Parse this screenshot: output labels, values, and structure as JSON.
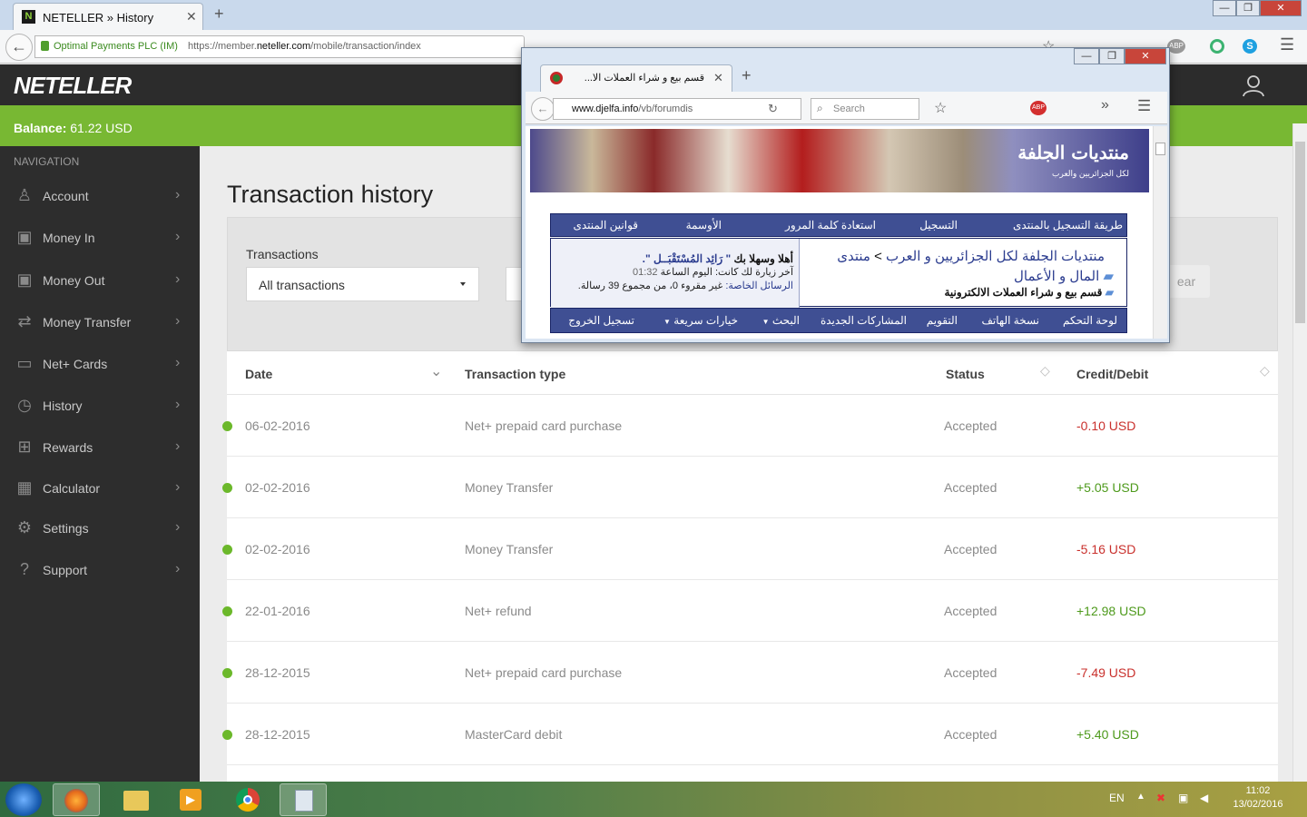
{
  "browser": {
    "tab_title": "NETELLER » History",
    "tab_favicon": "N",
    "identity": "Optimal Payments PLC (IM)",
    "url_prefix": "https://member.",
    "url_domain": "neteller.com",
    "url_suffix": "/mobile/transaction/index",
    "search_placeholder": "Search"
  },
  "header": {
    "logo": "NETELLER"
  },
  "balance": {
    "label": "Balance:",
    "value": "61.22 USD"
  },
  "sidebar": {
    "heading": "NAVIGATION",
    "items": [
      {
        "label": "Account",
        "icon": "user-icon"
      },
      {
        "label": "Money In",
        "icon": "money-in-icon"
      },
      {
        "label": "Money Out",
        "icon": "money-out-icon"
      },
      {
        "label": "Money Transfer",
        "icon": "transfer-icon"
      },
      {
        "label": "Net+ Cards",
        "icon": "card-icon"
      },
      {
        "label": "History",
        "icon": "clock-icon"
      },
      {
        "label": "Rewards",
        "icon": "gift-icon"
      },
      {
        "label": "Calculator",
        "icon": "calculator-icon"
      },
      {
        "label": "Settings",
        "icon": "gear-icon"
      },
      {
        "label": "Support",
        "icon": "question-icon"
      }
    ]
  },
  "main": {
    "title": "Transaction history",
    "filter_label": "Transactions",
    "filter_value": "All transactions",
    "clear_label": "ear",
    "columns": [
      "Date",
      "Transaction type",
      "Status",
      "Credit/Debit"
    ],
    "rows": [
      {
        "date": "06-02-2016",
        "type": "Net+ prepaid card purchase",
        "status": "Accepted",
        "amount": "-0.10 USD",
        "sign": "neg"
      },
      {
        "date": "02-02-2016",
        "type": "Money Transfer",
        "status": "Accepted",
        "amount": "+5.05 USD",
        "sign": "pos"
      },
      {
        "date": "02-02-2016",
        "type": "Money Transfer",
        "status": "Accepted",
        "amount": "-5.16 USD",
        "sign": "neg"
      },
      {
        "date": "22-01-2016",
        "type": "Net+ refund",
        "status": "Accepted",
        "amount": "+12.98 USD",
        "sign": "pos"
      },
      {
        "date": "28-12-2015",
        "type": "Net+ prepaid card purchase",
        "status": "Accepted",
        "amount": "-7.49 USD",
        "sign": "neg"
      },
      {
        "date": "28-12-2015",
        "type": "MasterCard debit",
        "status": "Accepted",
        "amount": "+5.40 USD",
        "sign": "pos"
      }
    ]
  },
  "popup": {
    "tab_title": "قسم بيع و شراء العملات الا...",
    "url_domain": "www.djelfa.info",
    "url_path": "/vb/forumdis",
    "search_placeholder": "Search",
    "banner_title": "منتديات الجلفة",
    "banner_sub": "لكل الجزائريين والعرب",
    "top_tabs": [
      "طريقة التسجيل بالمنتدى",
      "التسجيل",
      "استعادة كلمة المرور",
      "الأوسمة",
      "قوانين المنتدى"
    ],
    "breadcrumb_root": "منتديات الجلفة لكل الجزائريين و العرب",
    "breadcrumb_sep": ">",
    "breadcrumb_forum": "منتدى",
    "breadcrumb_sub": "المال و الأعمال",
    "breadcrumb_current": "قسم بيع و شراء العملات الالكترونية",
    "welcome_prefix": "أهلا وسهلا بك",
    "welcome_user": "\" رَائِد المُسْتَقْبَــل \".",
    "last_visit": "آخر زيارة لك كانت: اليوم الساعة",
    "last_visit_time": "01:32",
    "pm_label": "الرسائل الخاصة:",
    "pm_text": "غير مقروء 0، من مجموع 39 رسالة.",
    "bottom_tabs": [
      "لوحة التحكم",
      "نسخة الهاتف",
      "التقويم",
      "المشاركات الجديدة",
      "البحث",
      "خيارات سريعة",
      "تسجيل الخروج"
    ]
  },
  "taskbar": {
    "lang": "EN",
    "time": "11:02",
    "date": "13/02/2016"
  }
}
